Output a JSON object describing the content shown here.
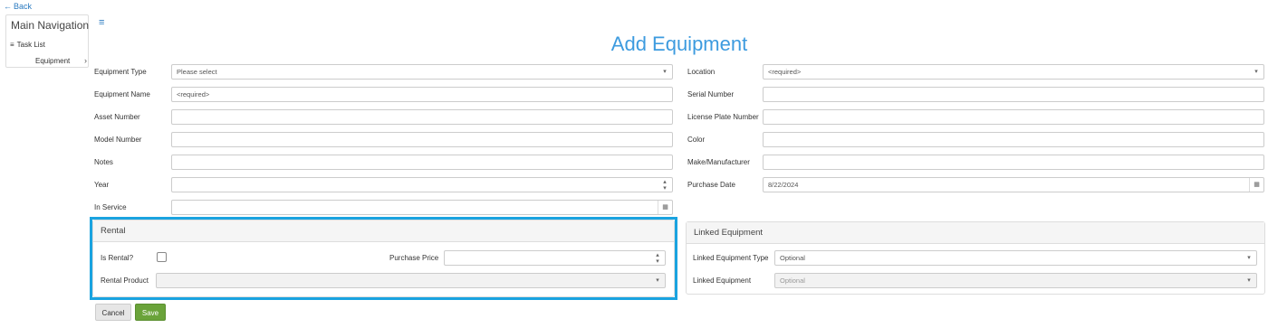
{
  "back": {
    "label": "Back"
  },
  "nav": {
    "title": "Main Navigation",
    "items": [
      {
        "label": "Task List"
      },
      {
        "label": "Equipment"
      }
    ]
  },
  "page": {
    "title": "Add Equipment"
  },
  "left_fields": [
    {
      "label": "Equipment Type",
      "value": "Please select"
    },
    {
      "label": "Equipment Name",
      "value": "<required>"
    },
    {
      "label": "Asset Number",
      "value": ""
    },
    {
      "label": "Model Number",
      "value": ""
    },
    {
      "label": "Notes",
      "value": ""
    },
    {
      "label": "Year",
      "value": ""
    },
    {
      "label": "In Service",
      "value": ""
    }
  ],
  "right_fields": [
    {
      "label": "Location",
      "value": "<required>"
    },
    {
      "label": "Serial Number",
      "value": ""
    },
    {
      "label": "License Plate Number",
      "value": ""
    },
    {
      "label": "Color",
      "value": ""
    },
    {
      "label": "Make/Manufacturer",
      "value": ""
    },
    {
      "label": "Purchase Date",
      "value": "8/22/2024"
    }
  ],
  "rental": {
    "title": "Rental",
    "is_rental_label": "Is Rental?",
    "purchase_price_label": "Purchase Price",
    "purchase_price_value": "",
    "rental_product_label": "Rental Product",
    "rental_product_value": ""
  },
  "linked": {
    "title": "Linked Equipment",
    "type_label": "Linked Equipment Type",
    "type_placeholder": "Optional",
    "equipment_label": "Linked Equipment",
    "equipment_placeholder": "Optional"
  },
  "buttons": {
    "cancel": "Cancel",
    "save": "Save"
  },
  "colors": {
    "accent": "#3d9bdf",
    "highlight": "#1aa3e0",
    "save": "#6aa33a"
  }
}
